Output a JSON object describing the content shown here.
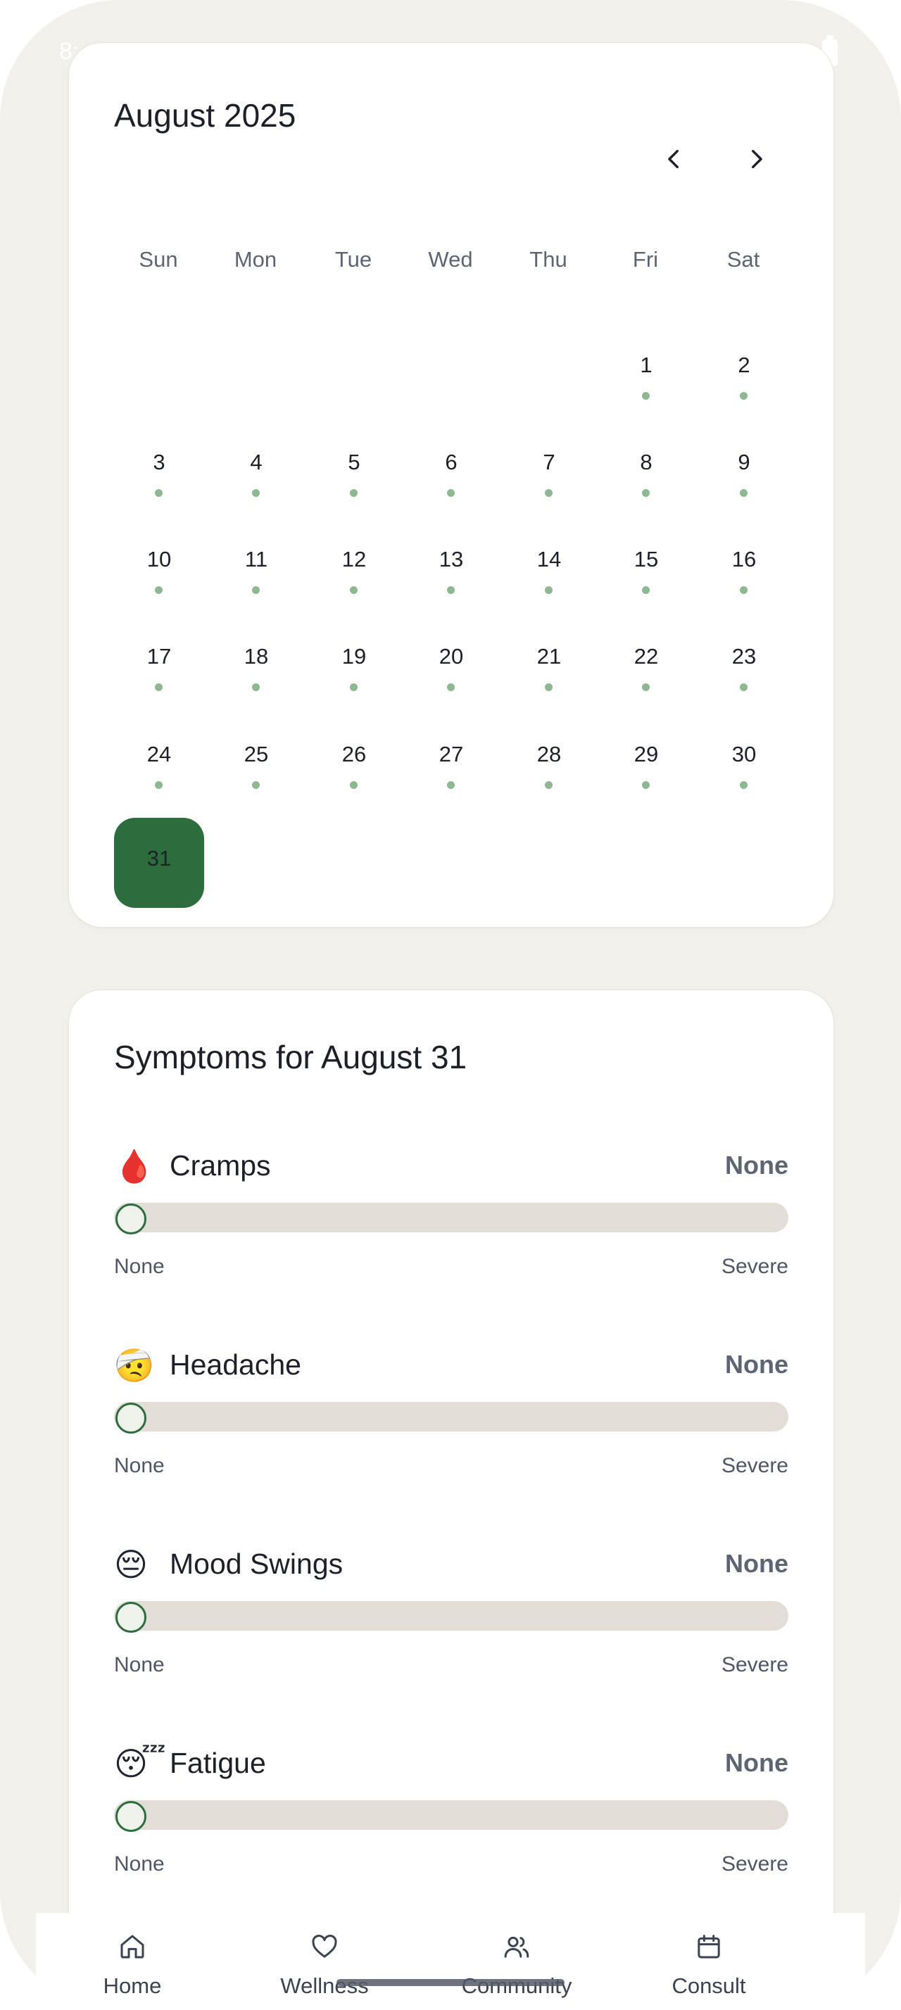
{
  "status_bar": {
    "time": "8:"
  },
  "calendar": {
    "month_label": "August 2025",
    "weekdays": [
      "Sun",
      "Mon",
      "Tue",
      "Wed",
      "Thu",
      "Fri",
      "Sat"
    ],
    "days": [
      "1",
      "2",
      "3",
      "4",
      "5",
      "6",
      "7",
      "8",
      "9",
      "10",
      "11",
      "12",
      "13",
      "14",
      "15",
      "16",
      "17",
      "18",
      "19",
      "20",
      "21",
      "22",
      "23",
      "24",
      "25",
      "26",
      "27",
      "28",
      "29",
      "30",
      "31"
    ],
    "selected_day": "31",
    "accent_color": "#2d6d3c",
    "dot_color": "#8db892"
  },
  "symptoms": {
    "title": "Symptoms for August 31",
    "items": [
      {
        "emoji": "🩸",
        "name": "Cramps",
        "value": "None",
        "min_label": "None",
        "max_label": "Severe",
        "level": 0
      },
      {
        "emoji": "🤕",
        "name": "Headache",
        "value": "None",
        "min_label": "None",
        "max_label": "Severe",
        "level": 0
      },
      {
        "emoji": "😔",
        "name": "Mood Swings",
        "value": "None",
        "min_label": "None",
        "max_label": "Severe",
        "level": 0
      },
      {
        "emoji": "😴",
        "name": "Fatigue",
        "value": "None",
        "min_label": "None",
        "max_label": "Severe",
        "level": 0
      }
    ]
  },
  "bottom_nav": {
    "items": [
      {
        "label": "Home",
        "icon": "home-icon"
      },
      {
        "label": "Wellness",
        "icon": "heart-icon"
      },
      {
        "label": "Community",
        "icon": "users-icon"
      },
      {
        "label": "Consult",
        "icon": "calendar-icon"
      }
    ]
  }
}
